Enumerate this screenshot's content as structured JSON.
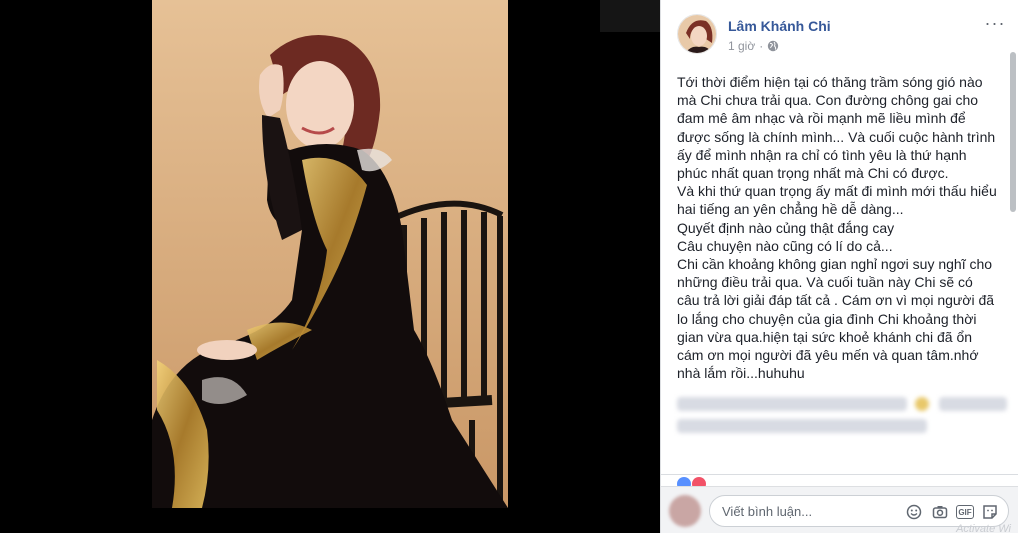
{
  "post": {
    "author": "Lâm Khánh Chi",
    "time": "1 giờ",
    "privacy_icon": "globe-icon",
    "more_label": "···",
    "paragraphs": [
      "Tới thời điểm hiện tại có thăng trầm sóng gió nào mà Chi chưa trải qua. Con đường chông gai cho đam mê âm nhạc và rồi mạnh mẽ liều mình để được sống là chính mình... Và cuối cuộc hành trình ấy để mình nhận ra chỉ có tình yêu là thứ hạnh phúc nhất quan trọng nhất mà Chi có được.",
      "Và khi thứ quan trọng ấy mất đi mình mới thấu hiểu hai tiếng an yên chẳng hề dễ dàng...",
      "Quyết định nào củng thật đắng cay",
      "Câu chuyện nào cũng có lí do cả...",
      "Chi cần khoảng không gian nghỉ ngơi suy nghĩ cho những điều trải qua. Và cuối tuần này Chi sẽ có câu trả lời giải đáp tất cả . Cám ơn vì mọi người đã lo lắng cho chuyện của gia đình Chi khoảng thời gian vừa qua.hiện tại sức khoẻ khánh chi đã ổn cám ơn mọi người đã yêu mến và quan tâm.nhớ nhà lắm rồi...huhuhu"
    ]
  },
  "comment_box": {
    "placeholder": "Viết bình luận...",
    "tools": [
      "emoji-icon",
      "camera-icon",
      "gif-icon",
      "sticker-icon"
    ],
    "gif_label": "GIF"
  },
  "watermark": "Activate Wi",
  "colors": {
    "author": "#365899",
    "meta": "#90949c",
    "text": "#1d2129",
    "comment_bar": "#f2f3f5",
    "viewer_bg": "#000000"
  }
}
